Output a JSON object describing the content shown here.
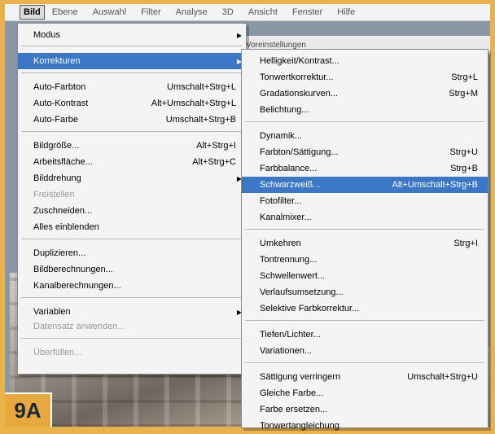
{
  "menubar": {
    "items": [
      "Bild",
      "Ebene",
      "Auswahl",
      "Filter",
      "Analyse",
      "3D",
      "Ansicht",
      "Fenster",
      "Hilfe"
    ],
    "active": "Bild"
  },
  "optionsbar": {
    "label": "Voreinstellungen"
  },
  "main_menu": {
    "items": [
      {
        "label": "Modus",
        "submenu": true
      },
      {
        "label": "Korrekturen",
        "submenu": true,
        "highlighted": true
      },
      {
        "label": "Auto-Farbton",
        "shortcut": "Umschalt+Strg+L"
      },
      {
        "label": "Auto-Kontrast",
        "shortcut": "Alt+Umschalt+Strg+L"
      },
      {
        "label": "Auto-Farbe",
        "shortcut": "Umschalt+Strg+B"
      },
      {
        "label": "Bildgröße...",
        "shortcut": "Alt+Strg+I"
      },
      {
        "label": "Arbeitsfläche...",
        "shortcut": "Alt+Strg+C"
      },
      {
        "label": "Bilddrehung",
        "submenu": true
      },
      {
        "label": "Freistellen",
        "disabled": true
      },
      {
        "label": "Zuschneiden..."
      },
      {
        "label": "Alles einblenden"
      },
      {
        "label": "Duplizieren..."
      },
      {
        "label": "Bildberechnungen..."
      },
      {
        "label": "Kanalberechnungen..."
      },
      {
        "label": "Variablen",
        "submenu": true
      },
      {
        "label": "Datensatz anwenden...",
        "disabled": true
      },
      {
        "label": "Überfüllen...",
        "disabled": true
      }
    ]
  },
  "sub_menu": {
    "items": [
      {
        "label": "Helligkeit/Kontrast..."
      },
      {
        "label": "Tonwertkorrektur...",
        "shortcut": "Strg+L"
      },
      {
        "label": "Gradationskurven...",
        "shortcut": "Strg+M"
      },
      {
        "label": "Belichtung..."
      },
      {
        "label": "Dynamik..."
      },
      {
        "label": "Farbton/Sättigung...",
        "shortcut": "Strg+U"
      },
      {
        "label": "Farbbalance...",
        "shortcut": "Strg+B"
      },
      {
        "label": "Schwarzweiß...",
        "shortcut": "Alt+Umschalt+Strg+B",
        "highlighted": true
      },
      {
        "label": "Fotofilter..."
      },
      {
        "label": "Kanalmixer..."
      },
      {
        "label": "Umkehren",
        "shortcut": "Strg+I"
      },
      {
        "label": "Tontrennung..."
      },
      {
        "label": "Schwellenwert..."
      },
      {
        "label": "Verlaufsumsetzung..."
      },
      {
        "label": "Selektive Farbkorrektur..."
      },
      {
        "label": "Tiefen/Lichter..."
      },
      {
        "label": "Variationen..."
      },
      {
        "label": "Sättigung verringern",
        "shortcut": "Umschalt+Strg+U"
      },
      {
        "label": "Gleiche Farbe..."
      },
      {
        "label": "Farbe ersetzen..."
      },
      {
        "label": "Tonwertangleichung"
      }
    ]
  },
  "badge": "9A",
  "colors": {
    "highlight": "#3a77c7",
    "frame": "#e9b24a"
  }
}
